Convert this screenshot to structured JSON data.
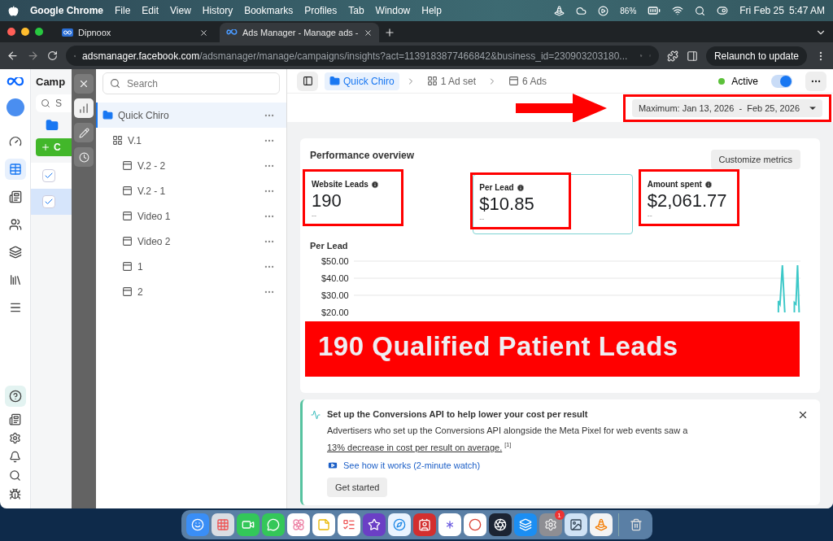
{
  "menu_bar": {
    "app": "Google Chrome",
    "menus": [
      "File",
      "Edit",
      "View",
      "History",
      "Bookmarks",
      "Profiles",
      "Tab",
      "Window",
      "Help"
    ],
    "battery": "86%",
    "date": "Fri Feb 25",
    "time": "5:47 AM"
  },
  "browser": {
    "tabs": [
      {
        "title": "Dipnoox",
        "selected": false
      },
      {
        "title": "Ads Manager - Manage ads -",
        "selected": true
      }
    ],
    "url_host": "adsmanager.facebook.com",
    "url_path": "/adsmanager/manage/campaigns/insights?act=1139183877466842&business_id=230903203180...",
    "relaunch": "Relaunch to update"
  },
  "campaign_column": {
    "title": "Camp",
    "search": "S",
    "create": "C",
    "rows": [
      {
        "checked": true,
        "selected": false
      },
      {
        "checked": true,
        "selected": true
      }
    ]
  },
  "tree": {
    "search_placeholder": "Search",
    "items": [
      {
        "label": "Quick Chiro",
        "kind": "campaign",
        "selected": true,
        "children": [
          {
            "label": "V.1",
            "kind": "adset",
            "selected": false,
            "children": [
              {
                "label": "V.2 - 2",
                "kind": "ad",
                "selected": false
              },
              {
                "label": "V.2 - 1",
                "kind": "ad",
                "selected": false
              },
              {
                "label": "Video 1",
                "kind": "ad",
                "selected": false
              },
              {
                "label": "Video 2",
                "kind": "ad",
                "selected": false
              },
              {
                "label": "1",
                "kind": "ad",
                "selected": false
              },
              {
                "label": "2",
                "kind": "ad",
                "selected": false
              }
            ]
          }
        ]
      }
    ]
  },
  "header": {
    "breadcrumb": [
      {
        "label": "Quick Chiro",
        "kind": "campaign",
        "selected": true
      },
      {
        "label": "1 Ad set",
        "kind": "adset",
        "selected": false
      },
      {
        "label": "6 Ads",
        "kind": "ad",
        "selected": false
      }
    ],
    "status": "Active",
    "on": true
  },
  "date_range": {
    "label": "Maximum: Jan 13, 2026  -  Feb 25, 2026",
    "annotated": true
  },
  "performance": {
    "title": "Performance overview",
    "customize": "Customize metrics",
    "metrics": [
      {
        "label": "Website Leads",
        "value": "190",
        "comparison": "--",
        "selected": false,
        "annotated": true
      },
      {
        "label": "Per Lead",
        "value": "$10.85",
        "comparison": "--",
        "selected": true,
        "annotated": true
      },
      {
        "label": "Amount spent",
        "value": "$2,061.77",
        "comparison": "--",
        "selected": false,
        "annotated": true
      }
    ],
    "chart_title": "Per Lead",
    "y_ticks": [
      "$50.00",
      "$40.00",
      "$30.00",
      "$20.00"
    ],
    "banner": "190 Qualified Patient Leads"
  },
  "conversions_card": {
    "title": "Set up the Conversions API to help lower your cost per result",
    "body": "Advertisers who set up the Conversions API alongside the Meta Pixel for web events saw a ",
    "link": "13% decrease in cost per result on average.",
    "footnote": "[1]",
    "video_link": "See how it works (2-minute watch)",
    "button": "Get started"
  },
  "dock": {
    "badge": "1"
  }
}
